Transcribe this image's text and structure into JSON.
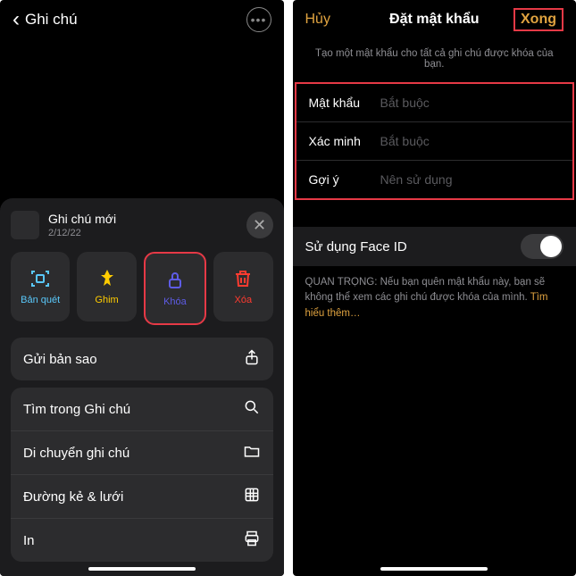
{
  "left": {
    "back_label": "Ghi chú",
    "sheet_title": "Ghi chú mới",
    "sheet_date": "2/12/22",
    "tiles": {
      "scan": "Bản quét",
      "pin": "Ghim",
      "lock": "Khóa",
      "delete": "Xóa"
    },
    "rows": {
      "send_copy": "Gửi bản sao",
      "find": "Tìm trong Ghi chú",
      "move": "Di chuyển ghi chú",
      "lines": "Đường kẻ & lưới",
      "print": "In"
    }
  },
  "right": {
    "cancel": "Hủy",
    "title": "Đặt mật khẩu",
    "done": "Xong",
    "subtitle": "Tạo một mật khẩu cho tất cả ghi chú được khóa của bạn.",
    "form": {
      "password_label": "Mật khẩu",
      "password_placeholder": "Bắt buộc",
      "verify_label": "Xác minh",
      "verify_placeholder": "Bắt buộc",
      "hint_label": "Gợi ý",
      "hint_placeholder": "Nên sử dụng"
    },
    "faceid_label": "Sử dụng Face ID",
    "warn_prefix": "QUAN TRỌNG: Nếu bạn quên mật khẩu này, bạn sẽ không thể xem các ghi chú được khóa của mình. ",
    "warn_link": "Tìm hiểu thêm…"
  }
}
